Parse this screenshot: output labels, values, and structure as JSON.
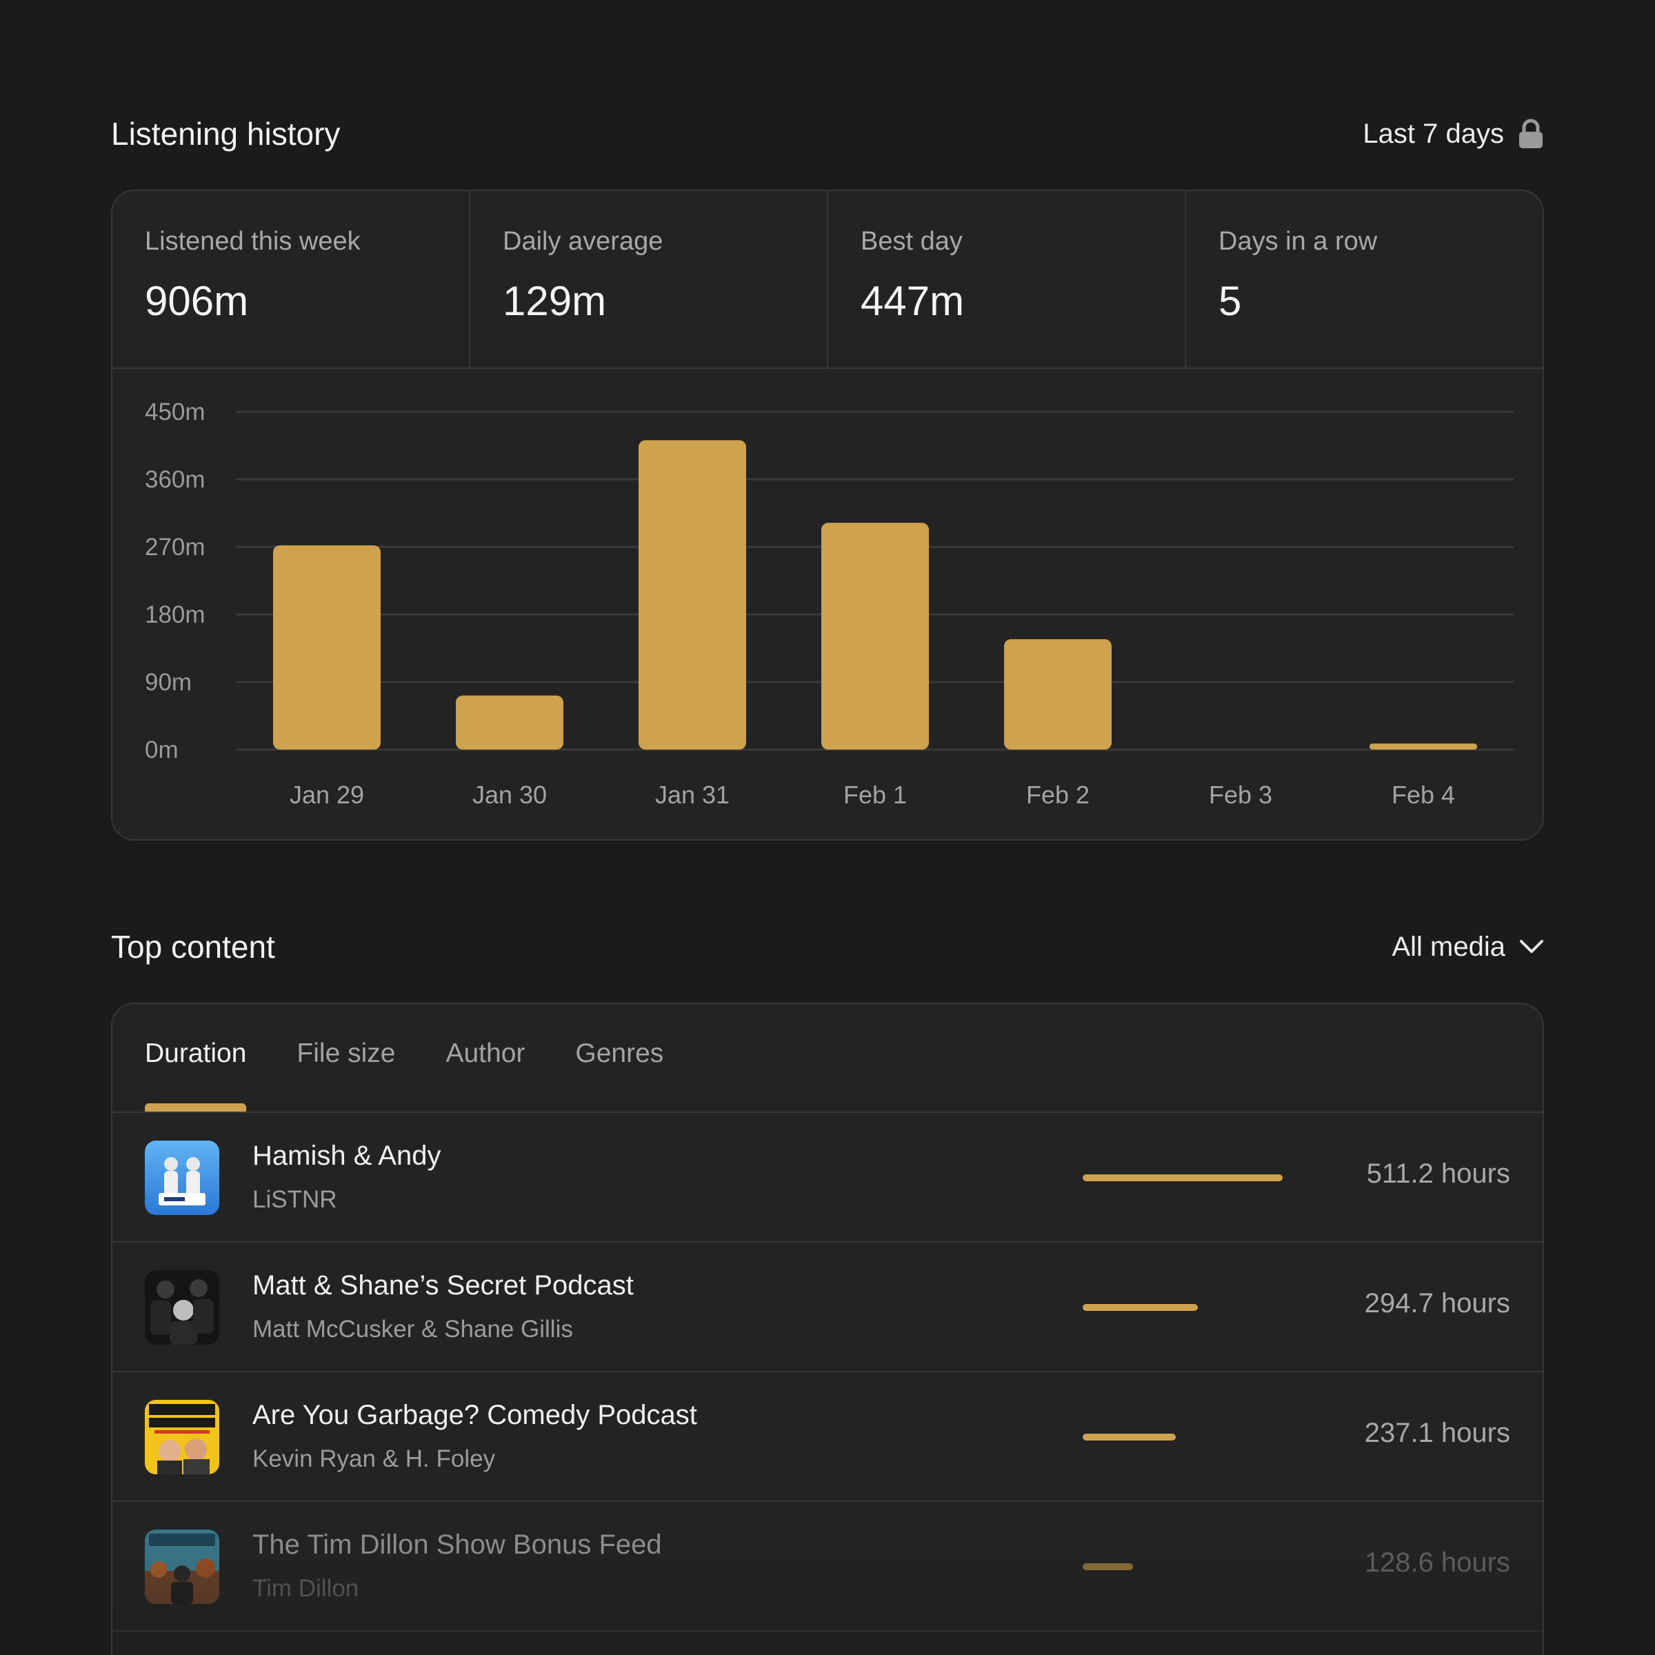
{
  "history": {
    "title": "Listening history",
    "range_label": "Last 7 days",
    "range_icon": "lock-icon",
    "stats": [
      {
        "label": "Listened this week",
        "value": "906m"
      },
      {
        "label": "Daily average",
        "value": "129m"
      },
      {
        "label": "Best day",
        "value": "447m"
      },
      {
        "label": "Days in a row",
        "value": "5"
      }
    ]
  },
  "chart_data": {
    "type": "bar",
    "categories": [
      "Jan 29",
      "Jan 30",
      "Jan 31",
      "Feb 1",
      "Feb 2",
      "Feb 3",
      "Feb 4"
    ],
    "values": [
      272,
      72,
      412,
      302,
      147,
      0,
      8
    ],
    "ylim": [
      0,
      450
    ],
    "yticks": [
      0,
      90,
      180,
      270,
      360,
      450
    ],
    "ytick_labels": [
      "0m",
      "90m",
      "180m",
      "270m",
      "360m",
      "450m"
    ],
    "grid": true,
    "bar_color": "#cfa24e"
  },
  "top_content": {
    "title": "Top content",
    "filter_label": "All media",
    "filter_icon": "chevron-down-icon",
    "tabs": [
      {
        "label": "Duration",
        "active": true
      },
      {
        "label": "File size",
        "active": false
      },
      {
        "label": "Author",
        "active": false
      },
      {
        "label": "Genres",
        "active": false
      }
    ],
    "items": [
      {
        "title": "Hamish & Andy",
        "author": "LiSTNR",
        "hours": 511.2,
        "value_label": "511.2 hours",
        "art": "hamish-andy-art"
      },
      {
        "title": "Matt & Shane’s Secret Podcast",
        "author": "Matt McCusker & Shane Gillis",
        "hours": 294.7,
        "value_label": "294.7 hours",
        "art": "secret-podcast-art"
      },
      {
        "title": "Are You Garbage? Comedy Podcast",
        "author": "Kevin Ryan & H. Foley",
        "hours": 237.1,
        "value_label": "237.1 hours",
        "art": "are-you-garbage-art"
      },
      {
        "title": "The Tim Dillon Show Bonus Feed",
        "author": "Tim Dillon",
        "hours": 128.6,
        "value_label": "128.6 hours",
        "art": "tim-dillon-art"
      }
    ]
  },
  "accent_color": "#cfa24e"
}
